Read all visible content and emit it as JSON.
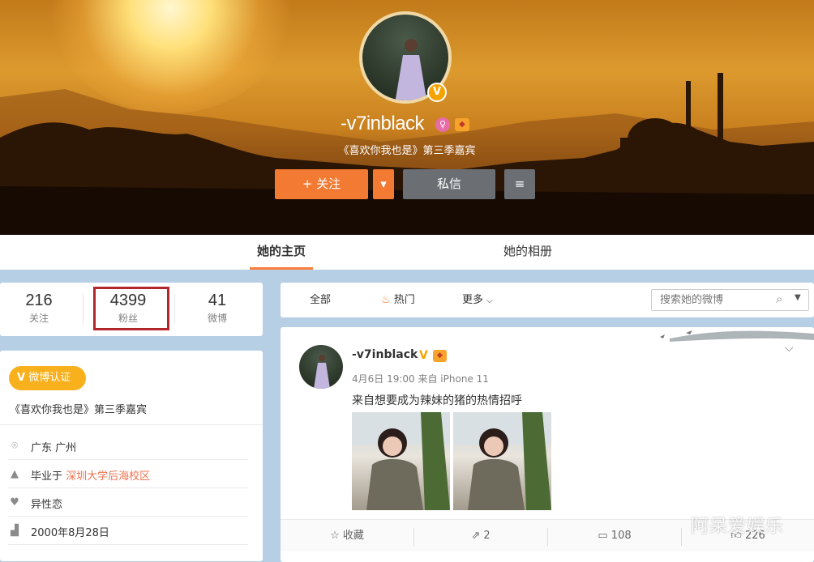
{
  "profile": {
    "username": "-v7inblack",
    "description": "《喜欢你我也是》第三季嘉宾",
    "follow_label": "+ 关注",
    "message_label": "私信",
    "verified_icon": "V"
  },
  "tabs": [
    {
      "label": "她的主页",
      "active": true
    },
    {
      "label": "她的相册",
      "active": false
    }
  ],
  "stats": [
    {
      "value": "216",
      "label": "关注"
    },
    {
      "value": "4399",
      "label": "粉丝"
    },
    {
      "value": "41",
      "label": "微博"
    }
  ],
  "info": {
    "verify_label": "微博认证",
    "verify_desc": "《喜欢你我也是》第三季嘉宾",
    "location": "广东 广州",
    "school_prefix": "毕业于",
    "school": "深圳大学后海校区",
    "orientation": "异性恋",
    "birthday": "2000年8月28日"
  },
  "filters": {
    "all": "全部",
    "hot": "热门",
    "more": "更多",
    "search_placeholder": "搜索她的微博"
  },
  "post": {
    "author": "-v7inblack",
    "meta": "4月6日 19:00 来自 iPhone 11",
    "text": "来自想要成为辣妹的猪的热情招呼",
    "actions": {
      "favorite": "收藏",
      "repost": "2",
      "comment": "108",
      "like": "226"
    }
  },
  "watermark": "阿呆爱娱乐",
  "colors": {
    "accent_orange": "#f27a33",
    "verify_gold": "#f8b01d",
    "highlight_red": "#b3262b",
    "link": "#eb7350"
  }
}
